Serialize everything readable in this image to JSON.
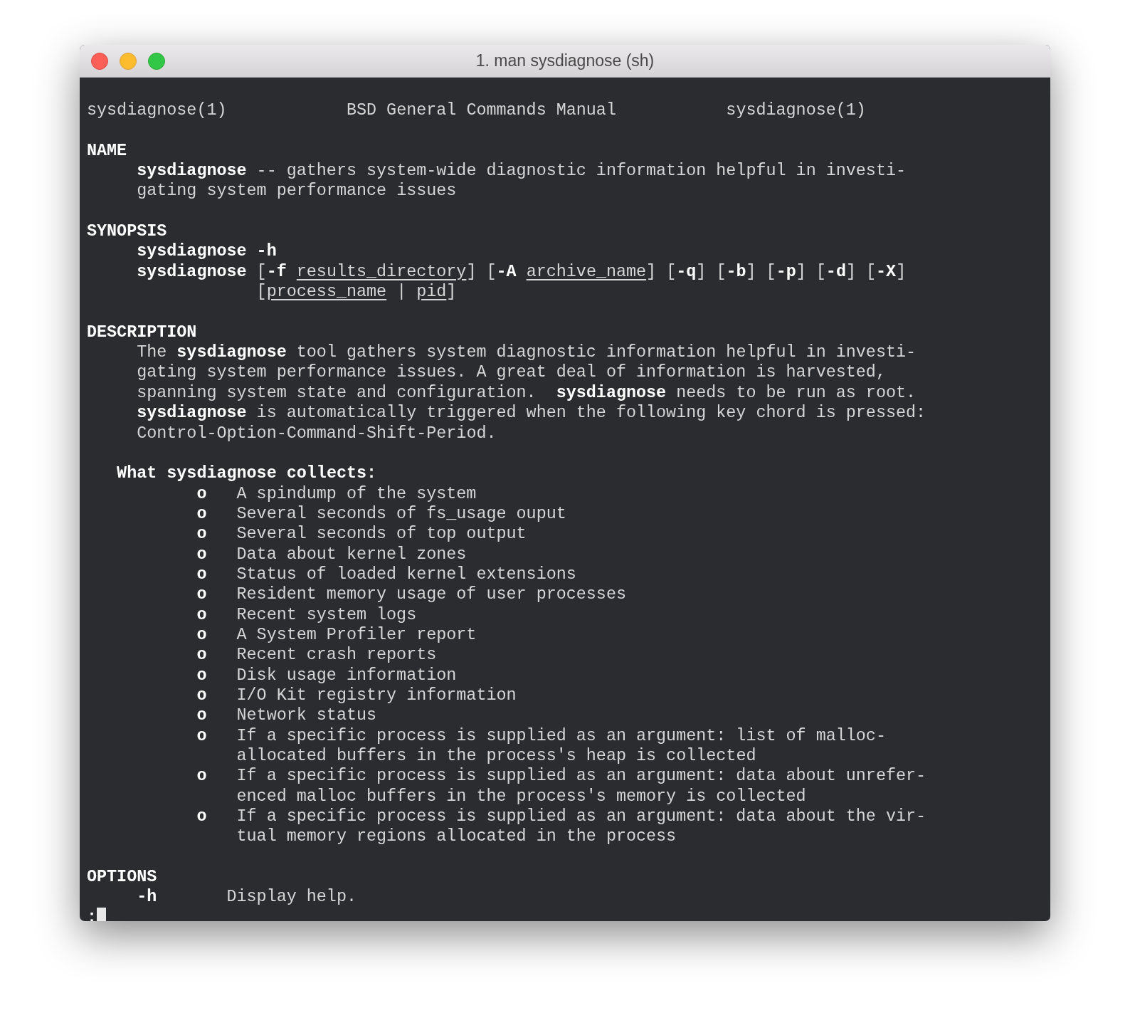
{
  "window": {
    "title": "1. man sysdiagnose (sh)"
  },
  "header": {
    "left": "sysdiagnose(1)",
    "center": "BSD General Commands Manual",
    "right": "sysdiagnose(1)"
  },
  "sections": [
    {
      "heading": "NAME",
      "lines": [
        {
          "kind": "body",
          "segments": [
            {
              "text": "sysdiagnose",
              "kind": "bold"
            },
            {
              "text": " -- gathers system-wide diagnostic information helpful in investi-",
              "kind": "plain"
            }
          ]
        },
        {
          "kind": "body",
          "segments": [
            {
              "text": "gating system performance issues",
              "kind": "plain"
            }
          ]
        }
      ]
    },
    {
      "heading": "SYNOPSIS",
      "lines": [
        {
          "kind": "body",
          "segments": [
            {
              "text": "sysdiagnose -h",
              "kind": "bold"
            }
          ]
        },
        {
          "kind": "body",
          "segments": [
            {
              "text": "sysdiagnose",
              "kind": "bold"
            },
            {
              "text": " [",
              "kind": "plain"
            },
            {
              "text": "-f ",
              "kind": "bold"
            },
            {
              "text": "results_directory",
              "kind": "underline"
            },
            {
              "text": "] [",
              "kind": "plain"
            },
            {
              "text": "-A ",
              "kind": "bold"
            },
            {
              "text": "archive_name",
              "kind": "underline"
            },
            {
              "text": "] [",
              "kind": "plain"
            },
            {
              "text": "-q",
              "kind": "bold"
            },
            {
              "text": "] [",
              "kind": "plain"
            },
            {
              "text": "-b",
              "kind": "bold"
            },
            {
              "text": "] [",
              "kind": "plain"
            },
            {
              "text": "-p",
              "kind": "bold"
            },
            {
              "text": "] [",
              "kind": "plain"
            },
            {
              "text": "-d",
              "kind": "bold"
            },
            {
              "text": "] [",
              "kind": "plain"
            },
            {
              "text": "-X",
              "kind": "bold"
            },
            {
              "text": "]",
              "kind": "plain"
            }
          ]
        },
        {
          "kind": "continuation",
          "segments": [
            {
              "text": "[",
              "kind": "plain"
            },
            {
              "text": "process_name",
              "kind": "underline"
            },
            {
              "text": " | ",
              "kind": "plain"
            },
            {
              "text": "pid",
              "kind": "underline"
            },
            {
              "text": "]",
              "kind": "plain"
            }
          ]
        }
      ]
    },
    {
      "heading": "DESCRIPTION",
      "lines": [
        {
          "kind": "body",
          "segments": [
            {
              "text": "The ",
              "kind": "plain"
            },
            {
              "text": "sysdiagnose",
              "kind": "bold"
            },
            {
              "text": " tool gathers system diagnostic information helpful in investi-",
              "kind": "plain"
            }
          ]
        },
        {
          "kind": "body",
          "segments": [
            {
              "text": "gating system performance issues. A great deal of information is harvested,",
              "kind": "plain"
            }
          ]
        },
        {
          "kind": "body",
          "segments": [
            {
              "text": "spanning system state and configuration.  ",
              "kind": "plain"
            },
            {
              "text": "sysdiagnose",
              "kind": "bold"
            },
            {
              "text": " needs to be run as root.",
              "kind": "plain"
            }
          ]
        },
        {
          "kind": "body",
          "segments": [
            {
              "text": "sysdiagnose",
              "kind": "bold"
            },
            {
              "text": " is automatically triggered when the following key chord is pressed:",
              "kind": "plain"
            }
          ]
        },
        {
          "kind": "body",
          "segments": [
            {
              "text": "Control-Option-Command-Shift-Period.",
              "kind": "plain"
            }
          ]
        }
      ],
      "subsection": {
        "title": "What sysdiagnose collects:",
        "items": [
          {
            "bullet": "o",
            "lines": [
              "A spindump of the system"
            ]
          },
          {
            "bullet": "o",
            "lines": [
              "Several seconds of fs_usage ouput"
            ]
          },
          {
            "bullet": "o",
            "lines": [
              "Several seconds of top output"
            ]
          },
          {
            "bullet": "o",
            "lines": [
              "Data about kernel zones"
            ]
          },
          {
            "bullet": "o",
            "lines": [
              "Status of loaded kernel extensions"
            ]
          },
          {
            "bullet": "o",
            "lines": [
              "Resident memory usage of user processes"
            ]
          },
          {
            "bullet": "o",
            "lines": [
              "Recent system logs"
            ]
          },
          {
            "bullet": "o",
            "lines": [
              "A System Profiler report"
            ]
          },
          {
            "bullet": "o",
            "lines": [
              "Recent crash reports"
            ]
          },
          {
            "bullet": "o",
            "lines": [
              "Disk usage information"
            ]
          },
          {
            "bullet": "o",
            "lines": [
              "I/O Kit registry information"
            ]
          },
          {
            "bullet": "o",
            "lines": [
              "Network status"
            ]
          },
          {
            "bullet": "o",
            "lines": [
              "If a specific process is supplied as an argument: list of malloc-",
              "allocated buffers in the process's heap is collected"
            ]
          },
          {
            "bullet": "o",
            "lines": [
              "If a specific process is supplied as an argument: data about unrefer-",
              "enced malloc buffers in the process's memory is collected"
            ]
          },
          {
            "bullet": "o",
            "lines": [
              "If a specific process is supplied as an argument: data about the vir-",
              "tual memory regions allocated in the process"
            ]
          }
        ]
      }
    },
    {
      "heading": "OPTIONS",
      "options": [
        {
          "flag": "-h",
          "description": "Display help."
        }
      ]
    }
  ],
  "prompt": ":"
}
